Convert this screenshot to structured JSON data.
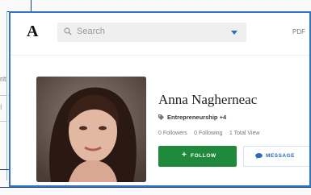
{
  "background": {
    "partial_text": "rit",
    "partial_text_2": "I"
  },
  "header": {
    "logo": "A",
    "search_placeholder": "Search",
    "pdf_label": "PDF"
  },
  "profile": {
    "name": "Anna Nagherneac",
    "category": "Entrepreneurship +4",
    "stats": {
      "followers": "0 Followers",
      "following": "0 Following",
      "views": "1 Total View"
    },
    "follow_label": "FOLLOW",
    "follow_icon": "+",
    "message_label": "MESSAGE"
  },
  "colors": {
    "accent": "#2b6bc1",
    "follow_green": "#1f8a3b",
    "window_border": "#2e75c6"
  }
}
